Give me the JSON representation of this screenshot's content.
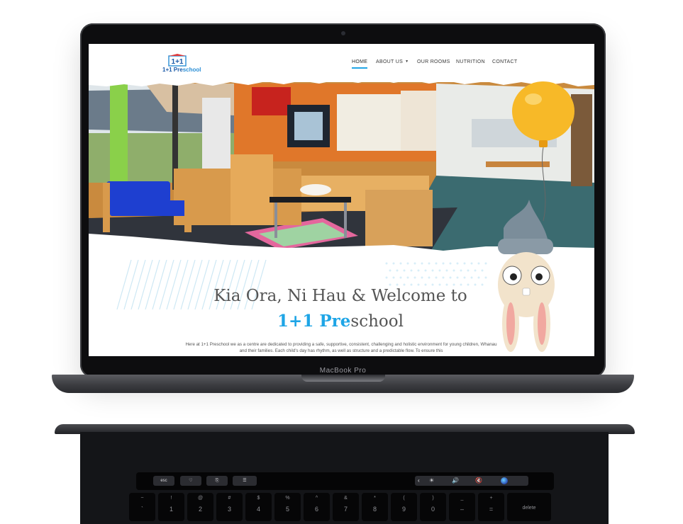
{
  "device": {
    "label": "MacBook Pro"
  },
  "site": {
    "logo": {
      "mark": "1+1",
      "brand_highlight": "1+1 Pre",
      "brand_rest": "school"
    },
    "nav": [
      {
        "label": "HOME",
        "active": true
      },
      {
        "label": "ABOUT US",
        "dropdown": true
      },
      {
        "label": "OUR ROOMS"
      },
      {
        "label": "NUTRITION"
      },
      {
        "label": "CONTACT"
      }
    ],
    "welcome": {
      "title": "Kia Ora, Ni Hau & Welcome to",
      "brand_highlight": "1+1 Pre",
      "brand_rest": "school",
      "intro": "Here at 1+1 Preschool we as a centre are dedicated to providing a safe, supportive, consistent, challenging and holistic environment for young children, Whanau and their families. Each child's day has rhythm, as well as structure and a predictable flow. To ensure this"
    },
    "colors": {
      "accent": "#1ea5e6",
      "logo_dark": "#1a5aa8",
      "balloon": "#f7b928",
      "bench": "#1e3fd0"
    }
  },
  "touchbar": {
    "esc": "esc",
    "icons": [
      "heart-icon",
      "share-icon",
      "sliders-icon"
    ],
    "controls": [
      "chevron-left-icon",
      "brightness-icon",
      "volume-icon",
      "mute-icon",
      "siri-icon"
    ],
    "glyphs": {
      "chevron": "‹",
      "brightness": "☀",
      "volume": "🔊",
      "mute": "🔇"
    }
  },
  "keyboard": {
    "keys": [
      {
        "top": "~",
        "bottom": "`"
      },
      {
        "top": "!",
        "bottom": "1"
      },
      {
        "top": "@",
        "bottom": "2"
      },
      {
        "top": "#",
        "bottom": "3"
      },
      {
        "top": "$",
        "bottom": "4"
      },
      {
        "top": "%",
        "bottom": "5"
      },
      {
        "top": "^",
        "bottom": "6"
      },
      {
        "top": "&",
        "bottom": "7"
      },
      {
        "top": "*",
        "bottom": "8"
      },
      {
        "top": "(",
        "bottom": "9"
      },
      {
        "top": ")",
        "bottom": "0"
      },
      {
        "top": "_",
        "bottom": "–"
      },
      {
        "top": "+",
        "bottom": "="
      },
      {
        "top": "",
        "bottom": "delete"
      }
    ]
  }
}
